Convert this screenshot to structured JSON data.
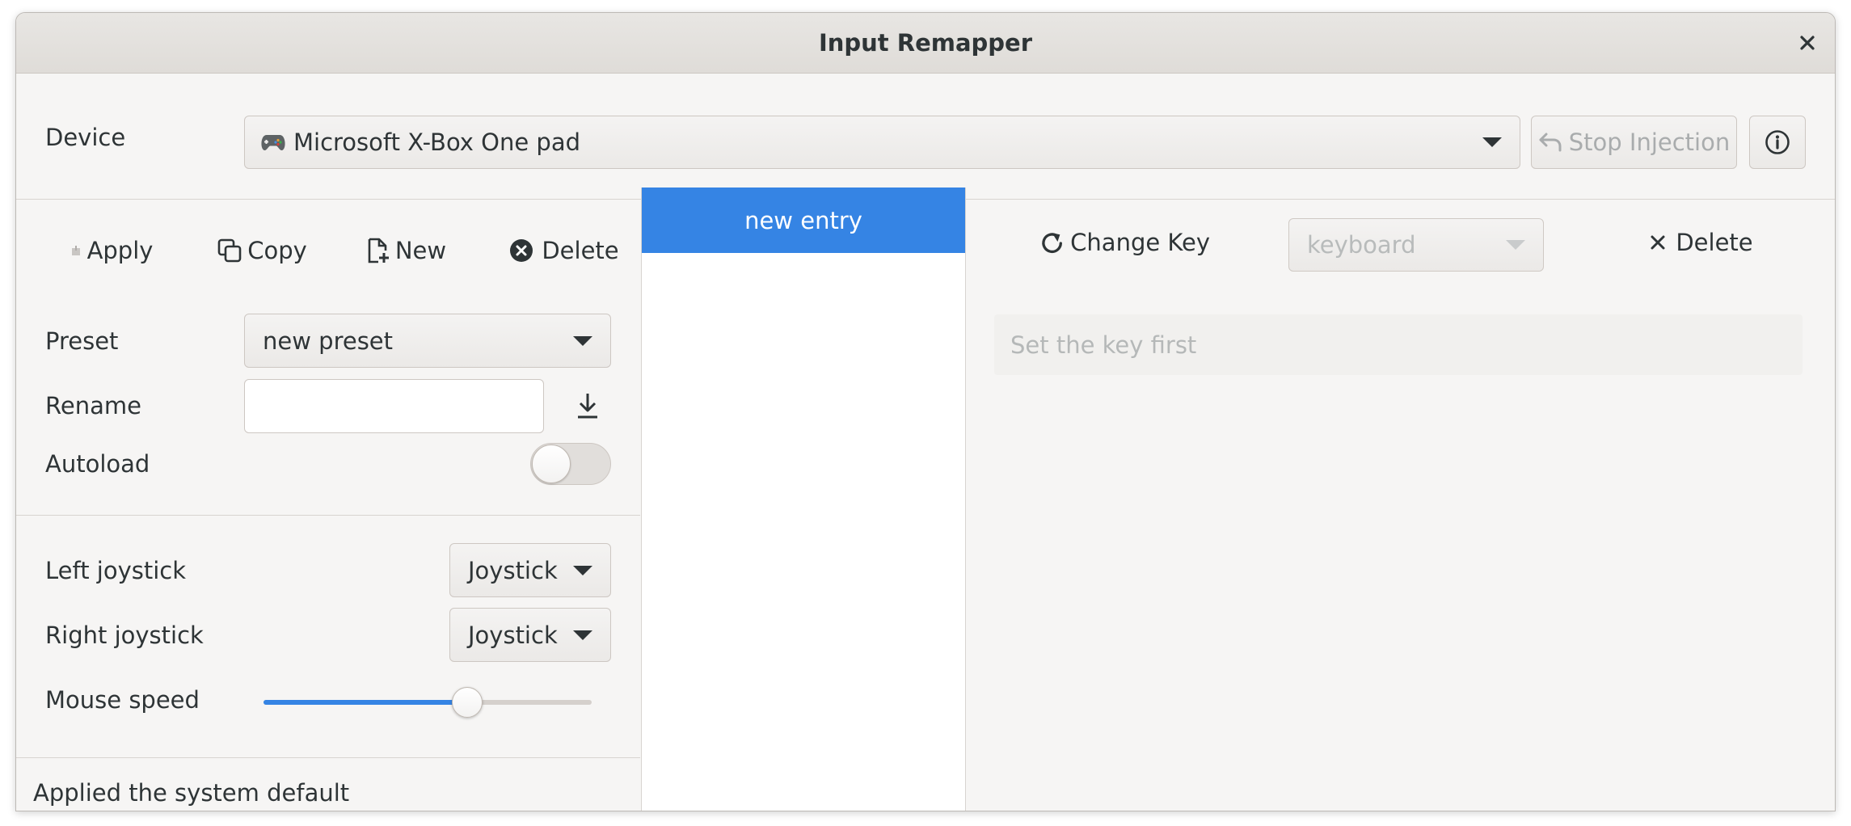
{
  "window": {
    "title": "Input Remapper"
  },
  "device_bar": {
    "label": "Device",
    "selected_device": "Microsoft X-Box One pad",
    "device_icon": "gamepad-icon",
    "stop_injection_label": "Stop Injection",
    "stop_injection_enabled": false
  },
  "toolbar": {
    "apply_label": "Apply",
    "copy_label": "Copy",
    "new_label": "New",
    "delete_label": "Delete"
  },
  "preset": {
    "label": "Preset",
    "selected": "new preset",
    "rename_label": "Rename",
    "rename_value": "",
    "autoload_label": "Autoload",
    "autoload_on": false
  },
  "joysticks": {
    "left_label": "Left joystick",
    "left_value": "Joystick",
    "right_label": "Right joystick",
    "right_value": "Joystick",
    "mouse_speed_label": "Mouse speed",
    "mouse_speed_fraction": 0.62
  },
  "status": {
    "text": "Applied the system default"
  },
  "mappings": {
    "entries": [
      "new entry"
    ],
    "selected_index": 0
  },
  "editor": {
    "change_key_label": "Change Key",
    "target_placeholder": "keyboard",
    "delete_label": "Delete",
    "entry_placeholder": "Set the key first"
  },
  "colors": {
    "accent": "#3584e4",
    "window_bg": "#f6f5f4",
    "disabled_text": "#a9acad"
  }
}
